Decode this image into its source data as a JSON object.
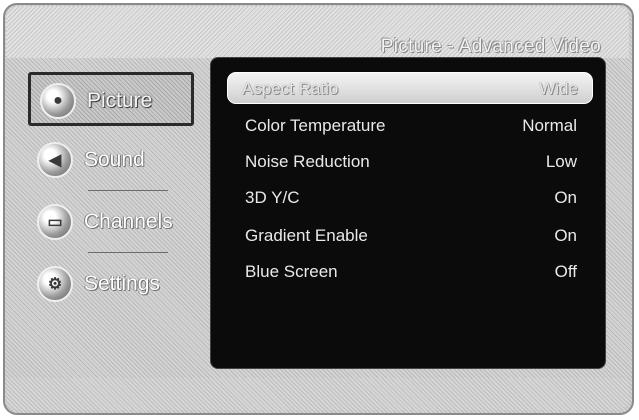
{
  "header": {
    "breadcrumb": "Picture - Advanced Video"
  },
  "sidebar": {
    "items": [
      {
        "label": "Picture",
        "icon": "picture-icon",
        "active": true
      },
      {
        "label": "Sound",
        "icon": "sound-icon",
        "active": false
      },
      {
        "label": "Channels",
        "icon": "channels-icon",
        "active": false
      },
      {
        "label": "Settings",
        "icon": "settings-icon",
        "active": false
      }
    ]
  },
  "menu": {
    "rows": [
      {
        "name": "Aspect Ratio",
        "value": "Wide",
        "selected": true
      },
      {
        "name": "Color Temperature",
        "value": "Normal"
      },
      {
        "name": "Noise Reduction",
        "value": "Low"
      },
      {
        "name": "3D Y/C",
        "value": "On"
      },
      {
        "name": "Gradient Enable",
        "value": "On"
      },
      {
        "name": "Blue Screen",
        "value": "Off"
      }
    ]
  },
  "colors": {
    "panel": "#0b0b0b",
    "text": "#e9e9e9",
    "highlight": "#f4f4f4"
  }
}
